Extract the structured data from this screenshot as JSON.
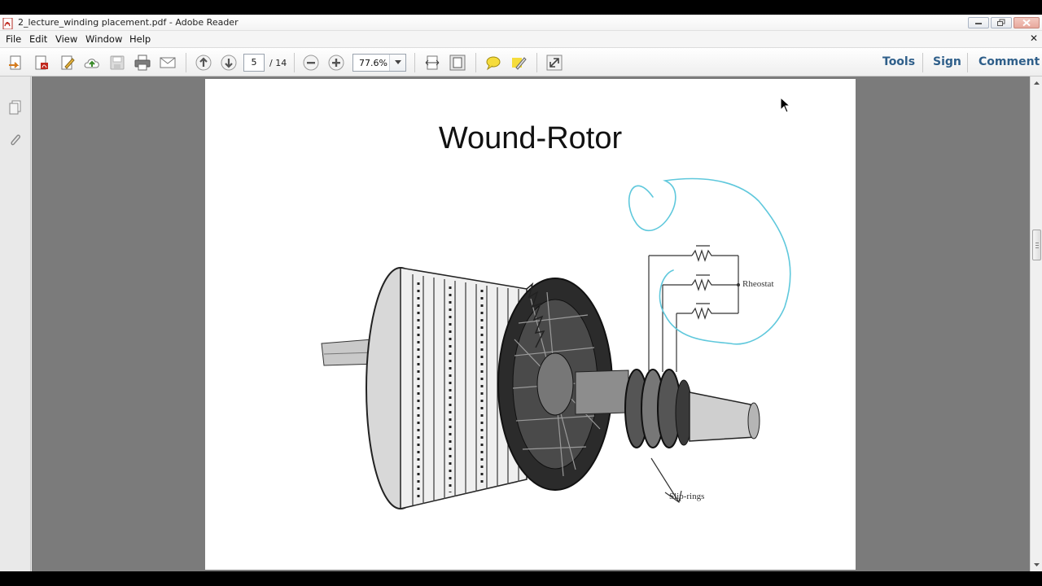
{
  "window": {
    "title": "2_lecture_winding placement.pdf - Adobe Reader"
  },
  "menu": {
    "items": [
      "File",
      "Edit",
      "View",
      "Window",
      "Help"
    ]
  },
  "toolbar": {
    "current_page": "5",
    "total_pages": "/ 14",
    "zoom": "77.6%",
    "tools_label": "Tools",
    "sign_label": "Sign",
    "comment_label": "Comment"
  },
  "document": {
    "slide_title": "Wound-Rotor",
    "label_rheostat": "Rheostat",
    "label_slip_rings": "Slip-rings"
  },
  "colors": {
    "annotation_ink": "#5fc8dc",
    "link_text": "#2f5f8a",
    "doc_background": "#7b7b7b"
  }
}
